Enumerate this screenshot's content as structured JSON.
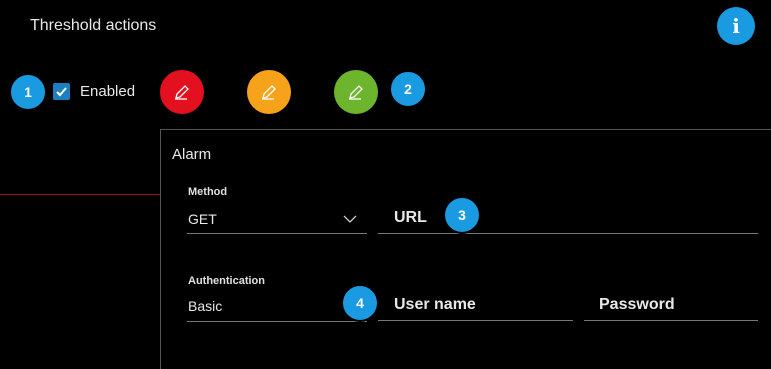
{
  "header": {
    "title": "Threshold actions",
    "info_label": "i"
  },
  "badges": [
    "1",
    "2",
    "3",
    "4"
  ],
  "enabled": {
    "label": "Enabled",
    "checked": true
  },
  "colors": {
    "accent": "#1a9ae0",
    "red": "#e3101f",
    "orange": "#f7a21b",
    "green": "#6cb52d"
  },
  "action_buttons": [
    {
      "color": "red",
      "icon": "pencil-icon"
    },
    {
      "color": "orange",
      "icon": "pencil-icon"
    },
    {
      "color": "green",
      "icon": "pencil-icon"
    }
  ],
  "panel": {
    "title": "Alarm",
    "method": {
      "label": "Method",
      "value": "GET"
    },
    "url": {
      "placeholder": "URL"
    },
    "authentication": {
      "label": "Authentication",
      "value": "Basic"
    },
    "username": {
      "placeholder": "User name"
    },
    "password": {
      "placeholder": "Password"
    }
  }
}
